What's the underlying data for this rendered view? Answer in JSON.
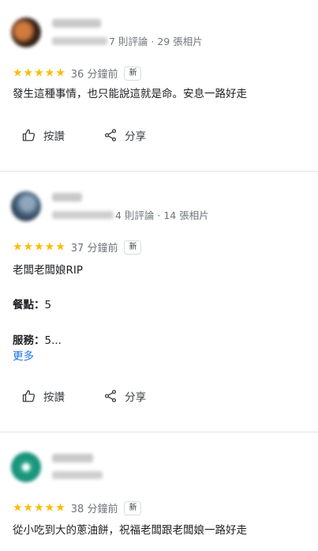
{
  "reviews": [
    {
      "meta_suffix": "7 則評論 · 29 張相片",
      "stars": "★★★★★",
      "time": "36 分鐘前",
      "badge": "新",
      "text": "發生這種事情，也只能說這就是命。安息一路好走"
    },
    {
      "meta_suffix": "4 則評論 · 14 張相片",
      "stars": "★★★★★",
      "time": "37 分鐘前",
      "badge": "新",
      "text": "老闆老闆娘RIP",
      "food_label": "餐點：",
      "food_value": "5",
      "service_label": "服務：",
      "service_value": "5...",
      "more": "更多"
    },
    {
      "stars": "★★★★★",
      "time": "38 分鐘前",
      "badge": "新",
      "text": "從小吃到大的蔥油餅，祝福老闆跟老闆娘一路好走"
    }
  ],
  "actions": {
    "like": "按讚",
    "share": "分享"
  },
  "icons": {
    "like": "thumb-up-icon",
    "share": "share-icon"
  },
  "colors": {
    "star": "#fbbc04",
    "link": "#1a73e8",
    "muted": "#70757a"
  }
}
